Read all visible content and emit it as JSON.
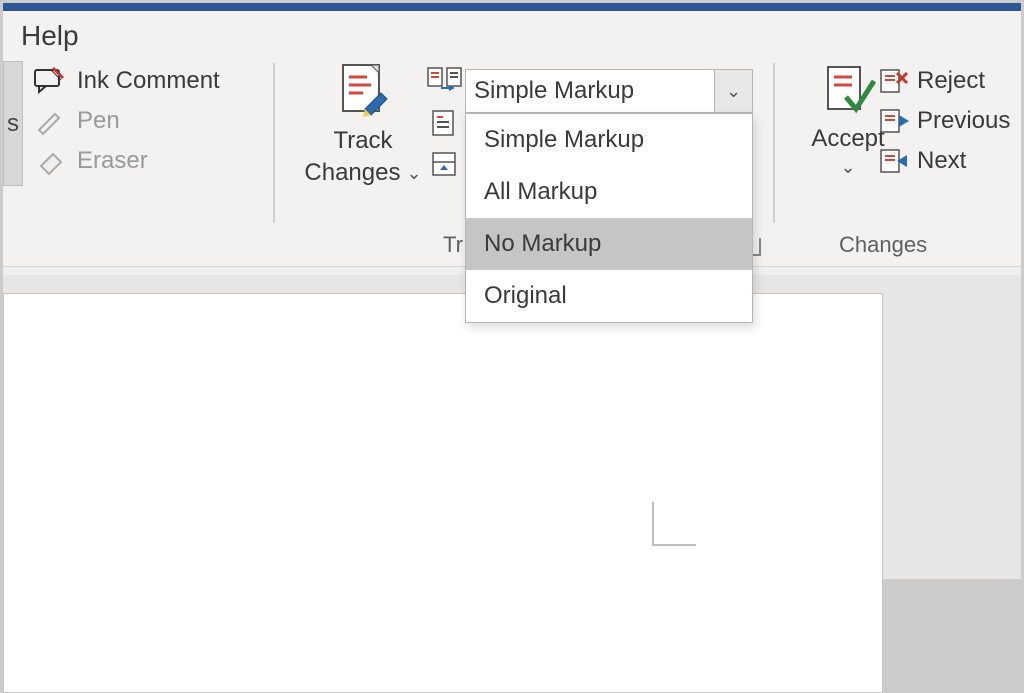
{
  "tab": {
    "help": "Help"
  },
  "ink": {
    "comment": "Ink Comment",
    "pen": "Pen",
    "eraser": "Eraser"
  },
  "tracking": {
    "track_changes_line1": "Track",
    "track_changes_line2": "Changes",
    "group_label": "Tr",
    "display_selected": "Simple Markup",
    "options": [
      "Simple Markup",
      "All Markup",
      "No Markup",
      "Original"
    ],
    "hovered_option_index": 2
  },
  "changes": {
    "accept": "Accept",
    "reject": "Reject",
    "previous": "Previous",
    "next": "Next",
    "group_label": "Changes"
  },
  "truncated_fragment": "s"
}
